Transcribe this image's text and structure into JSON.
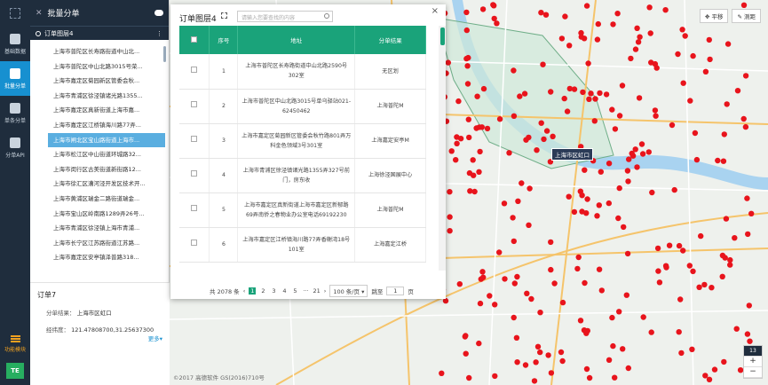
{
  "rail": {
    "items": [
      {
        "label": "基础数据",
        "icon": "layers-icon"
      },
      {
        "label": "批量分单",
        "icon": "batch-icon",
        "active": true
      },
      {
        "label": "单条分单",
        "icon": "document-icon"
      },
      {
        "label": "分单API",
        "icon": "api-icon"
      }
    ],
    "bottom_label": "功能模块",
    "avatar": "TE"
  },
  "panel": {
    "title": "批量分单",
    "layer_name": "订单图层4",
    "orders": [
      "上海市普陀区长寿路街道中山北...",
      "上海市普陀区中山北路3015号荣...",
      "上海市嘉定区菊园新区管委会秋...",
      "上海市青浦区徐泾镇诸光路1355...",
      "上海市嘉定区真新街道上海市嘉...",
      "上海市嘉定区江桥镇海川路77弄...",
      "上海市闸北区宝山路街道上海市...",
      "上海市松江区中山街道环城路32...",
      "上海市闵行区古美街道新街路12...",
      "上海市徐汇区漕河泾开发区技术开...",
      "上海市黄浦区瑞金二路街道瑞金...",
      "上海市宝山区岭南路1289弄26号...",
      "上海市青浦区徐泾镇上海市青浦...",
      "上海市长宁区江苏路街道江苏路...",
      "上海市嘉定区安亭镇泽普路318..."
    ],
    "selected_index": 6,
    "detail": {
      "title": "订单7",
      "result_label": "分单结果：",
      "result_value": "上海市区虹口",
      "coord_label": "经纬度：",
      "coord_value": "121.47808700,31.25637300",
      "more": "更多"
    }
  },
  "map": {
    "tool_pan": "平移",
    "tool_measure": "测距",
    "zoom_level": "13",
    "copyright": "©2017 高德软件 GS(2016)710号",
    "hover_label": "上海市区虹口"
  },
  "popup": {
    "title": "订单图层4",
    "search_placeholder": "请输入您要查找的内容",
    "columns": [
      "序号",
      "地址",
      "分单结果"
    ],
    "rows": [
      {
        "no": "1",
        "address": "上海市普陀区长寿路街道中山北路2590号302室",
        "result": "无区划"
      },
      {
        "no": "2",
        "address": "上海市普陀区中山北路3015号单乌驿站021-62450462",
        "result": "上海普陀M"
      },
      {
        "no": "3",
        "address": "上海市嘉定区菊园新区管委会秋竹路801弄万科金色领域3号301室",
        "result": "上海嘉定安亭M"
      },
      {
        "no": "4",
        "address": "上海市青浦区徐泾镇诸光路1355弄327号前门，房东收",
        "result": "上海徐泾国展中心"
      },
      {
        "no": "5",
        "address": "上海市嘉定区真新街道上海市嘉定区新郁路69弄南侨之春物业办公室电话69192230",
        "result": "上海普陀M"
      },
      {
        "no": "6",
        "address": "上海市嘉定区江桥镇海川路77弄香榭湾18号101室",
        "result": "上海嘉定江桥"
      }
    ],
    "pager": {
      "total": "共 2078 条",
      "pages": [
        "1",
        "2",
        "3",
        "4",
        "5",
        "···",
        "21"
      ],
      "page_size": "100 条/页",
      "goto_label": "跳至",
      "goto_value": "1",
      "goto_unit": "页"
    }
  }
}
